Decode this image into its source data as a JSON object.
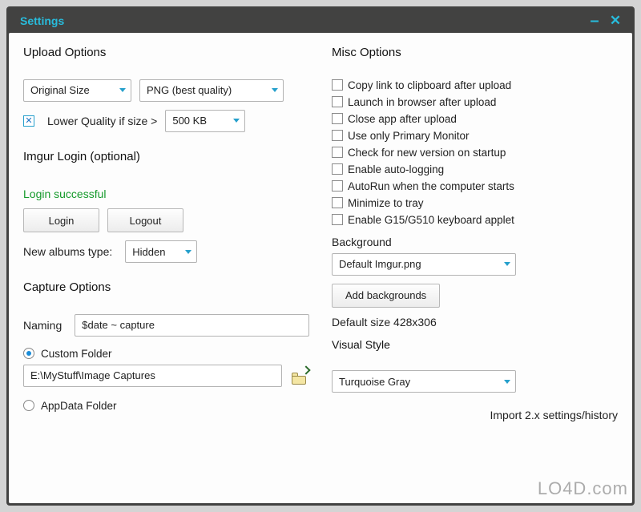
{
  "window": {
    "title": "Settings"
  },
  "upload": {
    "header": "Upload Options",
    "size_select": "Original Size",
    "format_select": "PNG (best quality)",
    "lower_quality_label": "Lower Quality if size >",
    "lower_quality_checked": true,
    "threshold": "500 KB"
  },
  "imgur": {
    "header": "Imgur Login (optional)",
    "status": "Login successful",
    "login_label": "Login",
    "logout_label": "Logout",
    "album_type_label": "New albums type:",
    "album_type_value": "Hidden"
  },
  "capture": {
    "header": "Capture Options",
    "naming_label": "Naming",
    "naming_value": "$date ~ capture",
    "custom_folder_label": "Custom Folder",
    "folder_path": "E:\\MyStuff\\Image Captures",
    "appdata_folder_label": "AppData Folder"
  },
  "misc": {
    "header": "Misc Options",
    "options": [
      "Copy link to clipboard after upload",
      "Launch in browser after upload",
      "Close app after upload",
      "Use only Primary Monitor",
      "Check for new version on startup",
      "Enable auto-logging",
      "AutoRun when the computer starts",
      "Minimize to tray",
      "Enable G15/G510 keyboard applet"
    ]
  },
  "background": {
    "header": "Background",
    "value": "Default Imgur.png",
    "add_label": "Add backgrounds",
    "default_size": "Default size 428x306"
  },
  "visual": {
    "header": "Visual Style",
    "value": "Turquoise Gray"
  },
  "footer": {
    "import_label": "Import 2.x settings/history"
  },
  "watermark": "LO4D.com"
}
